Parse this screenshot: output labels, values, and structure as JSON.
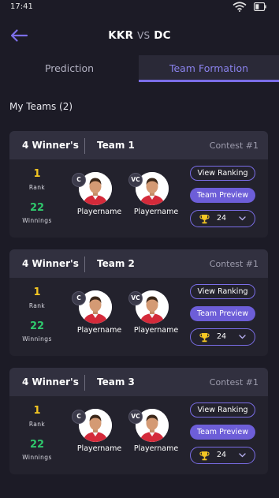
{
  "status_bar": {
    "time": "17:41",
    "icons": [
      "wifi-icon",
      "battery-icon"
    ]
  },
  "header": {
    "team_a": "KKR",
    "vs": "VS",
    "team_b": "DC",
    "back_icon": "arrow-left-icon"
  },
  "tabs": [
    {
      "label": "Prediction",
      "active": false
    },
    {
      "label": "Team Formation",
      "active": true
    }
  ],
  "section_title": "My Teams (2)",
  "colors": {
    "accent": "#7b6ee8",
    "rank": "#f3c623",
    "winnings": "#2fc76c",
    "background": "#1c1b26"
  },
  "cards": [
    {
      "winners": "4 Winner's",
      "team": "Team 1",
      "contest": "Contest #1",
      "rank_value": "1",
      "rank_label": "Rank",
      "winnings_value": "22",
      "winnings_label": "Winnings",
      "players": [
        {
          "badge": "C",
          "name": "Playername"
        },
        {
          "badge": "VC",
          "name": "Playername"
        }
      ],
      "view_ranking": "View Ranking",
      "team_preview": "Team Preview",
      "trophy_count": "24"
    },
    {
      "winners": "4 Winner's",
      "team": "Team 2",
      "contest": "Contest #1",
      "rank_value": "1",
      "rank_label": "Rank",
      "winnings_value": "22",
      "winnings_label": "Winnings",
      "players": [
        {
          "badge": "C",
          "name": "Playername"
        },
        {
          "badge": "VC",
          "name": "Playername"
        }
      ],
      "view_ranking": "View Ranking",
      "team_preview": "Team Preview",
      "trophy_count": "24"
    },
    {
      "winners": "4 Winner's",
      "team": "Team 3",
      "contest": "Contest #1",
      "rank_value": "1",
      "rank_label": "Rank",
      "winnings_value": "22",
      "winnings_label": "Winnings",
      "players": [
        {
          "badge": "C",
          "name": "Playername"
        },
        {
          "badge": "VC",
          "name": "Playername"
        }
      ],
      "view_ranking": "View Ranking",
      "team_preview": "Team Preview",
      "trophy_count": "24"
    }
  ]
}
